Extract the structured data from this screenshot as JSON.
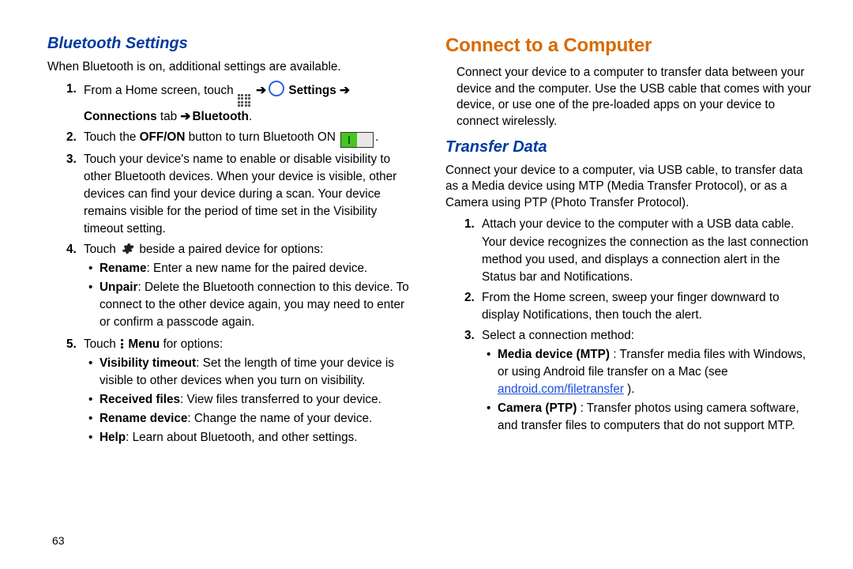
{
  "page_number": "63",
  "left": {
    "h1": "Bluetooth Settings",
    "intro": "When Bluetooth is on, additional settings are available.",
    "s1_a": "From a Home screen, touch ",
    "arrow": " ➔ ",
    "s1_b": " Settings",
    "s1_c": "Connections",
    "s1_d": " tab ",
    "s1_e": "Bluetooth",
    "s2_a": "Touch the ",
    "s2_b": "OFF/ON",
    "s2_c": " button to turn Bluetooth ON ",
    "s3": "Touch your device's name to enable or disable visibility to other Bluetooth devices. When your device is visible, other devices can find your device during a scan. Your device remains visible for the period of time set in the Visibility timeout setting.",
    "s4_a": "Touch ",
    "s4_b": " beside a paired device for options:",
    "s4_items": {
      "i1_b": "Rename",
      "i1_t": ": Enter a new name for the paired device.",
      "i2_b": "Unpair",
      "i2_t": ": Delete the Bluetooth connection to this device. To connect to the other device again, you may need to enter or confirm a passcode again."
    },
    "s5_a": "Touch ",
    "s5_b": " Menu",
    "s5_c": " for options:",
    "s5_items": {
      "i1_b": "Visibility timeout",
      "i1_t": ": Set the length of time your device is visible to other devices when you turn on visibility.",
      "i2_b": "Received files",
      "i2_t": ": View files transferred to your device.",
      "i3_b": "Rename device",
      "i3_t": ": Change the name of your device.",
      "i4_b": "Help",
      "i4_t": ": Learn about Bluetooth, and other settings."
    }
  },
  "right": {
    "h1": "Connect to a Computer",
    "intro": "Connect your device to a computer to transfer data between your device and the computer. Use the USB cable that comes with your device, or use one of the pre-loaded apps on your device to connect wirelessly.",
    "h2": "Transfer Data",
    "para2": "Connect your device to a computer, via USB cable, to transfer data as a Media device using MTP (Media Transfer Protocol), or as a Camera using PTP (Photo Transfer Protocol).",
    "s1": "Attach your device to the computer with a USB data cable. Your device recognizes the connection as the last connection method you used, and displays a connection alert in the Status bar and Notifications.",
    "s2": "From the Home screen, sweep your finger downward to display Notifications, then touch the alert.",
    "s3_lead": "Select a connection method:",
    "s3_items": {
      "i1_b": "Media device (MTP)",
      "i1_t1": ": Transfer media files with Windows, or using Android file transfer on a Mac (see ",
      "i1_link": "android.com/filetransfer",
      "i1_t2": ").",
      "i2_b": "Camera (PTP)",
      "i2_t": ": Transfer photos using camera software, and transfer files to computers that do not support MTP."
    }
  }
}
